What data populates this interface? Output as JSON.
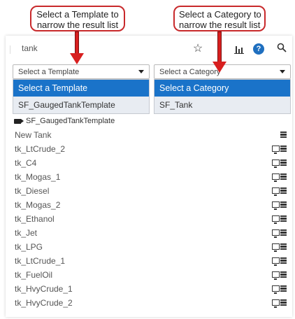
{
  "callouts": {
    "left": "Select a Template to\nnarrow the result list",
    "right": "Select a Category to\nnarrow the result list"
  },
  "search": {
    "value": "tank"
  },
  "template_select": {
    "value": "Select a Template",
    "options": [
      "Select a Template",
      "SF_GaugedTankTemplate"
    ]
  },
  "category_select": {
    "value": "Select a Category",
    "options": [
      "Select a Category",
      "SF_Tank"
    ]
  },
  "template_group": "SF_GaugedTankTemplate",
  "items": [
    "New Tank",
    "tk_LtCrude_2",
    "tk_C4",
    "tk_Mogas_1",
    "tk_Diesel",
    "tk_Mogas_2",
    "tk_Ethanol",
    "tk_Jet",
    "tk_LPG",
    "tk_LtCrude_1",
    "tk_FuelOil",
    "tk_HvyCrude_1",
    "tk_HvyCrude_2"
  ],
  "icons": {
    "favorite": "star-icon",
    "trend": "bar-chart-icon",
    "help": "?",
    "search": "search-icon"
  },
  "colors": {
    "accent": "#1a73c9",
    "callout_border": "#c8292b",
    "arrow": "#d81f1f"
  }
}
